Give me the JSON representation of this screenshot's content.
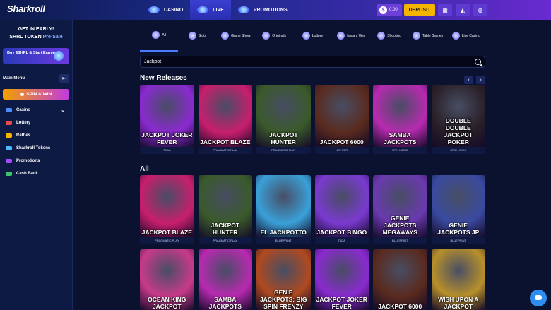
{
  "brand": {
    "logo": "Sharkroll"
  },
  "topnav": [
    {
      "label": "CASINO",
      "active": false
    },
    {
      "label": "LIVE",
      "active": true
    },
    {
      "label": "PROMOTIONS",
      "active": false
    }
  ],
  "wallet": {
    "balance": "0.00",
    "coin_symbol": "$",
    "deposit_label": "DEPOSIT"
  },
  "sidebar": {
    "promo_line1": "GET IN EARLY!",
    "promo_line2": "SHRL TOKEN",
    "promo_highlight": "Pre-Sale",
    "buy_label": "Buy $SHRL & Start Earning!",
    "main_menu": "Main Menu",
    "spin_label": "SPIN & WIN",
    "items": [
      {
        "label": "Casino",
        "color": "#4b8bff"
      },
      {
        "label": "Lottery",
        "color": "#e84b4b"
      },
      {
        "label": "Raffles",
        "color": "#f5b400"
      },
      {
        "label": "Sharkroll Tokens",
        "color": "#4bb8ff"
      },
      {
        "label": "Promotions",
        "color": "#a64bff"
      },
      {
        "label": "Cash Back",
        "color": "#3ec46a"
      }
    ]
  },
  "categories": [
    "All",
    "Slots",
    "Game Show",
    "Originals",
    "Lottery",
    "Instant Win",
    "Shooting",
    "Table Games",
    "Live Casino"
  ],
  "search": {
    "value": "Jackpot"
  },
  "sections": {
    "new_releases": "New Releases",
    "all": "All"
  },
  "new_releases": [
    {
      "title": "JACKPOT JOKER FEVER",
      "provider": "TADA",
      "bg": "#8a2ad0"
    },
    {
      "title": "JACKPOT BLAZE",
      "provider": "PRAGMATIC PLAY",
      "bg": "#c81e6e"
    },
    {
      "title": "JACKPOT HUNTER",
      "provider": "PRAGMATIC PLAY",
      "bg": "#3a5a2a"
    },
    {
      "title": "JACKPOT 6000",
      "provider": "NET ENT",
      "bg": "#5a2a1e"
    },
    {
      "title": "SAMBA JACKPOTS",
      "provider": "SPIN LOGIC",
      "bg": "#b82ab0"
    },
    {
      "title": "DOUBLE DOUBLE JACKPOT POKER",
      "provider": "SPIN LOGIC",
      "bg": "#2a2028"
    }
  ],
  "all_games": [
    {
      "title": "JACKPOT BLAZE",
      "provider": "PRAGMATIC PLAY",
      "bg": "#c81e6e"
    },
    {
      "title": "JACKPOT HUNTER",
      "provider": "PRAGMATIC PLAY",
      "bg": "#3a5a2a"
    },
    {
      "title": "EL JACKPOTTO",
      "provider": "BLUEPRINT",
      "bg": "#3aa0d8"
    },
    {
      "title": "JACKPOT BINGO",
      "provider": "TADA",
      "bg": "#7a3ad0"
    },
    {
      "title": "GENIE JACKPOTS MEGAWAYS",
      "provider": "BLUEPRINT",
      "bg": "#6a3ab0"
    },
    {
      "title": "GENIE JACKPOTS JP",
      "provider": "BLUEPRINT",
      "bg": "#3a4aa0"
    }
  ],
  "all_games_row2": [
    {
      "title": "OCEAN KING JACKPOT",
      "bg": "#c83a8a"
    },
    {
      "title": "SAMBA JACKPOTS",
      "bg": "#b82ab0"
    },
    {
      "title": "GENIE JACKPOTS: BIG SPIN FRENZY",
      "bg": "#b04a20"
    },
    {
      "title": "JACKPOT JOKER FEVER",
      "bg": "#8a2ad0"
    },
    {
      "title": "JACKPOT 6000",
      "bg": "#5a2a1e"
    },
    {
      "title": "WISH UPON A JACKPOT",
      "bg": "#b8902a"
    }
  ]
}
